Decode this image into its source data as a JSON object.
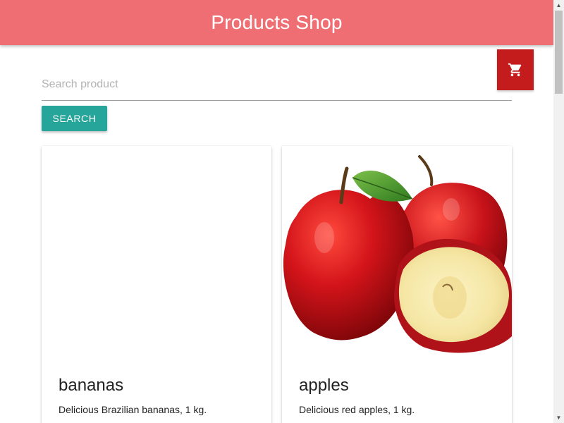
{
  "header": {
    "title": "Products Shop",
    "background_color": "#ef6e73"
  },
  "cart": {
    "icon": "shopping-cart-icon",
    "background_color": "#c41c1c"
  },
  "search": {
    "placeholder": "Search product",
    "value": "",
    "button_label": "SEARCH",
    "button_color": "#26a69a"
  },
  "products": [
    {
      "name": "bananas",
      "description": "Delicious Brazilian bananas, 1 kg.",
      "image": "bananas-image"
    },
    {
      "name": "apples",
      "description": "Delicious red apples, 1 kg.",
      "image": "red-apples-image"
    }
  ]
}
